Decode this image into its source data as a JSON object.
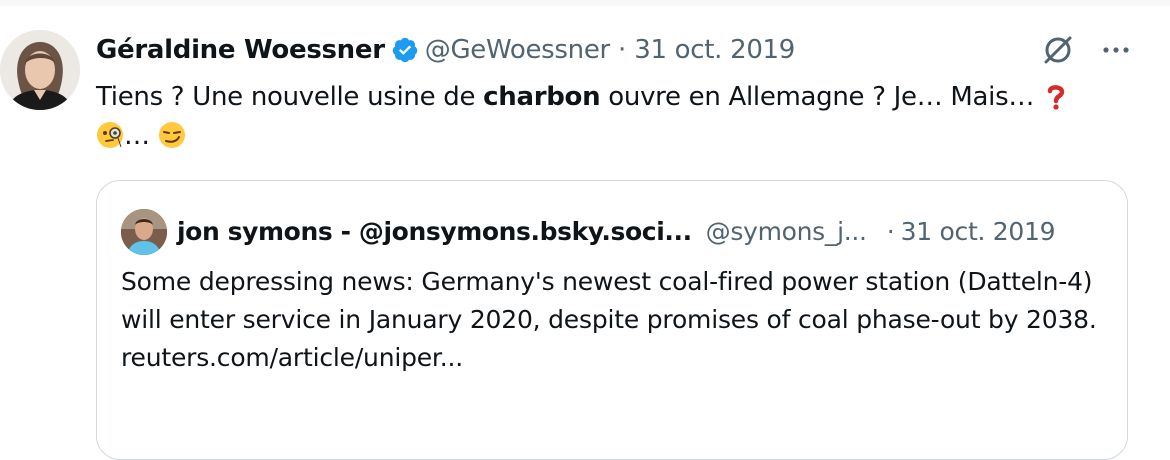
{
  "tweet": {
    "author_name": "Géraldine Woessner",
    "handle": "@GeWoessner",
    "separator": "·",
    "date": "31 oct. 2019",
    "text_before": "Tiens ? Une nouvelle usine de ",
    "text_bold": "charbon",
    "text_after": " ouvre en Allemagne ? Je… Mais… ",
    "ellipsis_after_emoji": "… ",
    "emoji_1": "red-question-mark",
    "emoji_2": "face-with-monocle",
    "emoji_3": "smirking-face"
  },
  "quoted": {
    "author_name": "jon symons - @jonsymons.bsky.soci...",
    "handle": "@symons_j...",
    "separator": "·",
    "date": "31 oct. 2019",
    "text": "Some depressing news: Germany's newest coal-fired power station (Datteln-4) will enter service in January 2020, despite promises of coal phase-out by 2038.",
    "link": "reuters.com/article/uniper..."
  },
  "icons": {
    "verified": "verified-badge-icon",
    "grok": "grok-icon",
    "more": "more-options-icon"
  },
  "colors": {
    "text": "#0f1419",
    "secondary": "#536471",
    "verified": "#1d9bf0",
    "border": "#cfd9de"
  }
}
